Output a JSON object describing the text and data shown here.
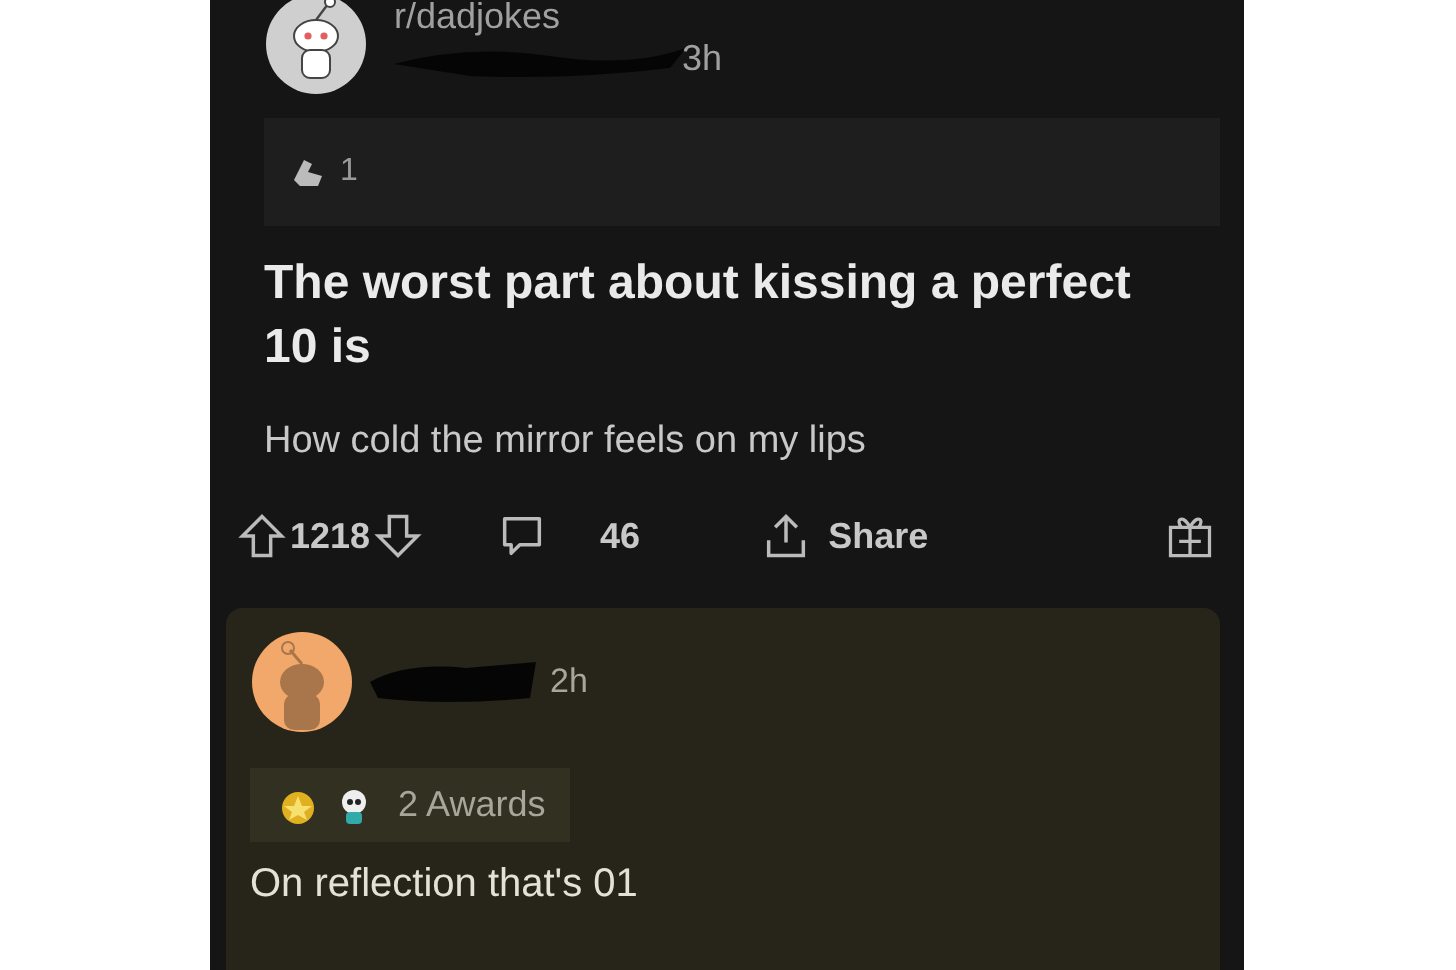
{
  "post": {
    "subreddit": "r/dadjokes",
    "age": "3h",
    "award_count": "1",
    "title": "The worst part about kissing a perfect 10 is",
    "body": "How cold the mirror feels on my lips",
    "actions": {
      "score": "1218",
      "comments": "46",
      "share": "Share"
    }
  },
  "comment": {
    "age": "2h",
    "awards": "2 Awards",
    "text": "On reflection that's 01"
  }
}
